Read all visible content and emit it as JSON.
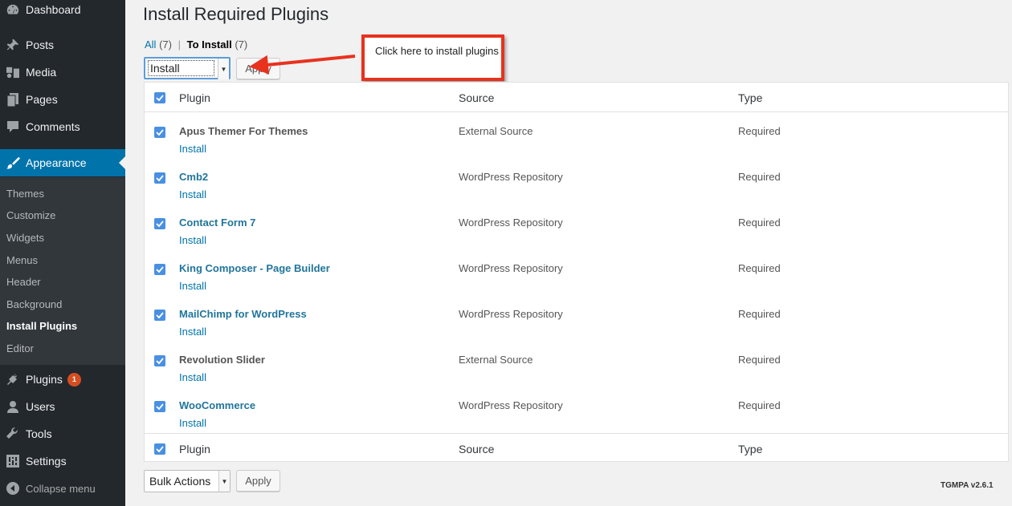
{
  "sidebar": {
    "dashboard": "Dashboard",
    "posts": "Posts",
    "media": "Media",
    "pages": "Pages",
    "comments": "Comments",
    "appearance": "Appearance",
    "submenu": [
      "Themes",
      "Customize",
      "Widgets",
      "Menus",
      "Header",
      "Background",
      "Install Plugins",
      "Editor"
    ],
    "plugins": "Plugins",
    "plugins_badge": "1",
    "users": "Users",
    "tools": "Tools",
    "settings": "Settings",
    "collapse": "Collapse menu"
  },
  "page": {
    "title": "Install Required Plugins",
    "filter_all": "All",
    "filter_all_count": "(7)",
    "filter_to_install": "To Install",
    "filter_to_install_count": "(7)",
    "top_action": "Install",
    "apply": "Apply",
    "bottom_action": "Bulk Actions",
    "callout": "Click here to install plugins",
    "version": "TGMPA v2.6.1"
  },
  "table": {
    "col_plugin": "Plugin",
    "col_source": "Source",
    "col_type": "Type",
    "rows": [
      {
        "name": "Apus Themer For Themes",
        "action": "Install",
        "source": "External Source",
        "type": "Required"
      },
      {
        "name": "Cmb2",
        "action": "Install",
        "source": "WordPress Repository",
        "type": "Required"
      },
      {
        "name": "Contact Form 7",
        "action": "Install",
        "source": "WordPress Repository",
        "type": "Required"
      },
      {
        "name": "King Composer - Page Builder",
        "action": "Install",
        "source": "WordPress Repository",
        "type": "Required"
      },
      {
        "name": "MailChimp for WordPress",
        "action": "Install",
        "source": "WordPress Repository",
        "type": "Required"
      },
      {
        "name": "Revolution Slider",
        "action": "Install",
        "source": "External Source",
        "type": "Required"
      },
      {
        "name": "WooCommerce",
        "action": "Install",
        "source": "WordPress Repository",
        "type": "Required"
      }
    ]
  },
  "colors": {
    "sidebar_bg": "#23282d",
    "active_bg": "#0073aa",
    "link": "#0073aa",
    "callout_border": "#e8321e",
    "badge": "#d54e21",
    "checkbox": "#4a90e2"
  }
}
